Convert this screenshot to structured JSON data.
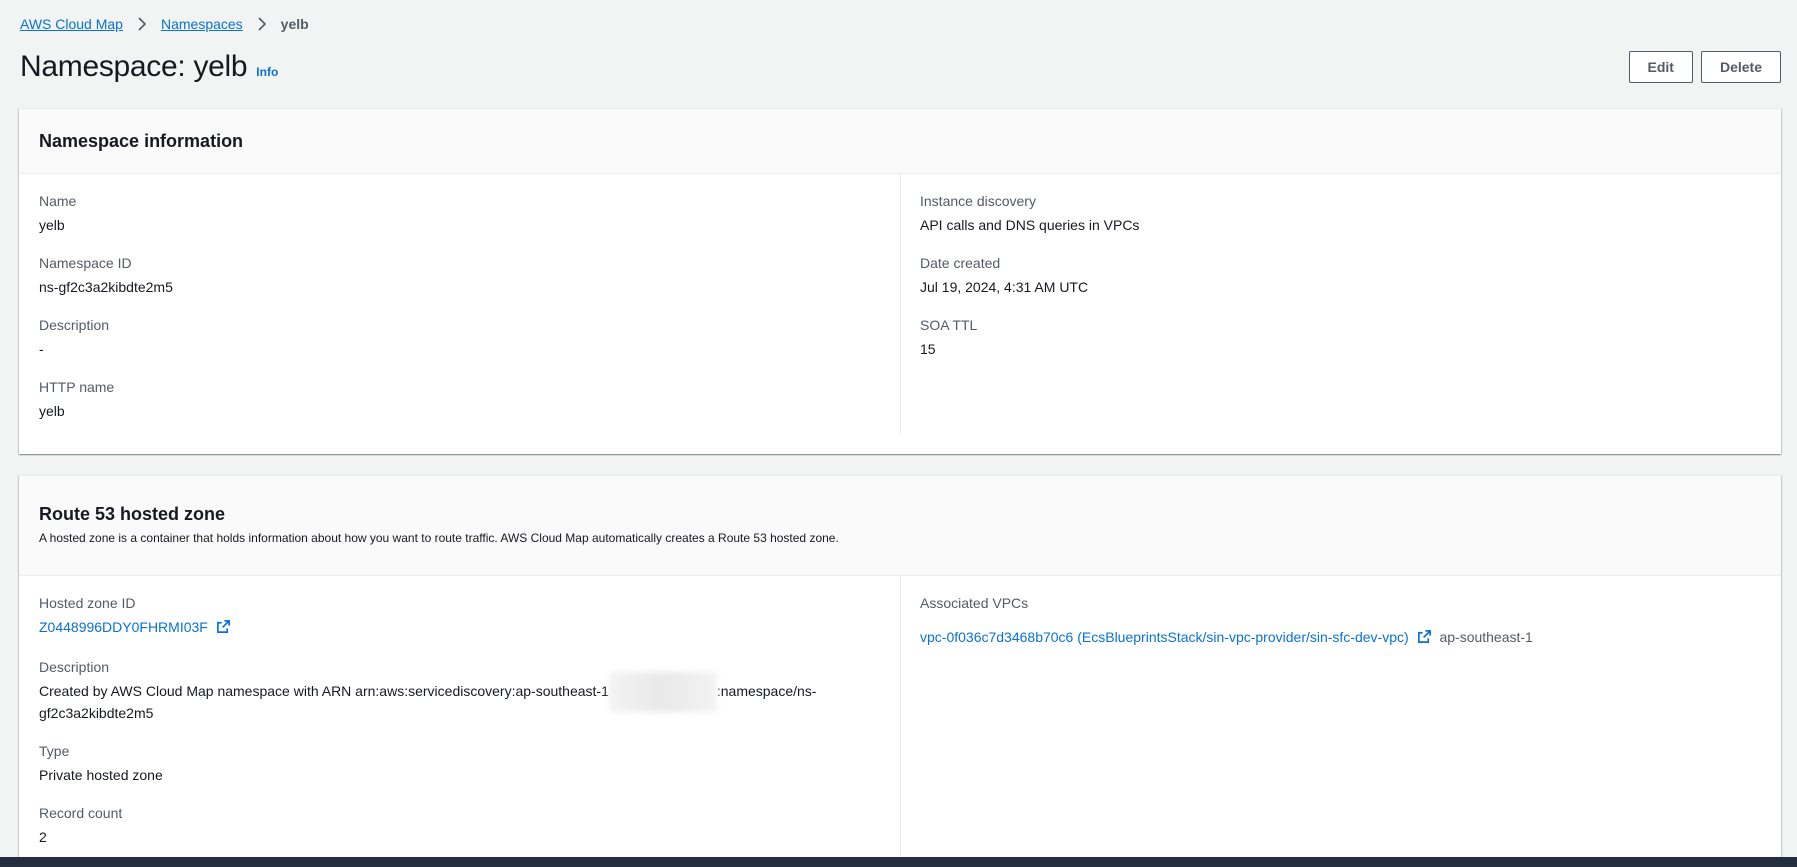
{
  "breadcrumbs": {
    "items": [
      {
        "label": "AWS Cloud Map"
      },
      {
        "label": "Namespaces"
      }
    ],
    "current": "yelb"
  },
  "header": {
    "title": "Namespace: yelb",
    "info_label": "Info",
    "edit_label": "Edit",
    "delete_label": "Delete"
  },
  "namespace_info": {
    "title": "Namespace information",
    "left": [
      {
        "label": "Name",
        "value": "yelb"
      },
      {
        "label": "Namespace ID",
        "value": "ns-gf2c3a2kibdte2m5"
      },
      {
        "label": "Description",
        "value": "-"
      },
      {
        "label": "HTTP name",
        "value": "yelb"
      }
    ],
    "right": [
      {
        "label": "Instance discovery",
        "value": "API calls and DNS queries in VPCs"
      },
      {
        "label": "Date created",
        "value": "Jul 19, 2024, 4:31 AM UTC"
      },
      {
        "label": "SOA TTL",
        "value": "15"
      }
    ]
  },
  "hosted_zone": {
    "title": "Route 53 hosted zone",
    "description": "A hosted zone is a container that holds information about how you want to route traffic. AWS Cloud Map automatically creates a Route 53 hosted zone.",
    "hosted_zone_id_label": "Hosted zone ID",
    "hosted_zone_id": "Z0448996DDY0FHRMI03F",
    "description_label": "Description",
    "description_value_prefix": "Created by AWS Cloud Map namespace with ARN arn:aws:servicediscovery:ap-southeast-1",
    "description_value_suffix": ":namespace/ns-gf2c3a2kibdte2m5",
    "type_label": "Type",
    "type_value": "Private hosted zone",
    "record_count_label": "Record count",
    "record_count_value": "2",
    "associated_vpcs_label": "Associated VPCs",
    "vpc_link": "vpc-0f036c7d3468b70c6 (EcsBlueprintsStack/sin-vpc-provider/sin-sfc-dev-vpc)",
    "vpc_region": "ap-southeast-1"
  },
  "icons": {
    "breadcrumb_separator": "chevron-right-icon",
    "external_link": "external-link-icon"
  },
  "colors": {
    "link": "#0972d3",
    "background": "#f2f3f3",
    "footer": "#232f3e"
  }
}
